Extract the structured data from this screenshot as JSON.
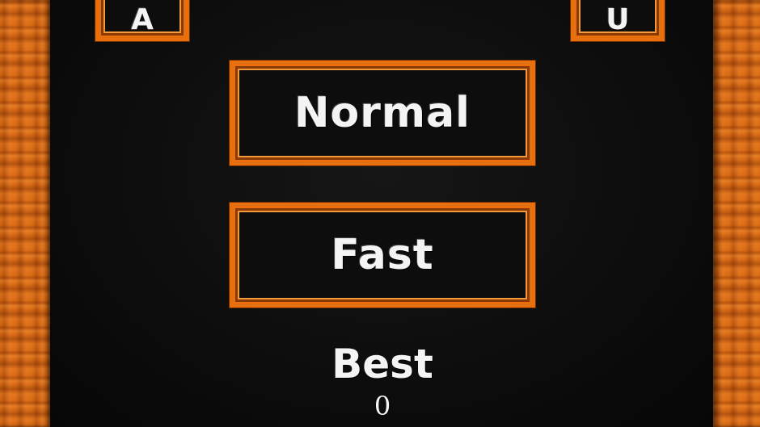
{
  "top_buttons": {
    "left_label": "A",
    "right_label": "U"
  },
  "modes": [
    {
      "label": "Normal"
    },
    {
      "label": "Fast"
    }
  ],
  "best": {
    "label": "Best",
    "value": "0"
  },
  "colors": {
    "frame_orange": "#e86f0e",
    "wood_orange": "#d96a14",
    "board_black": "#0c0c0c",
    "text_white": "#f4f4f4"
  }
}
